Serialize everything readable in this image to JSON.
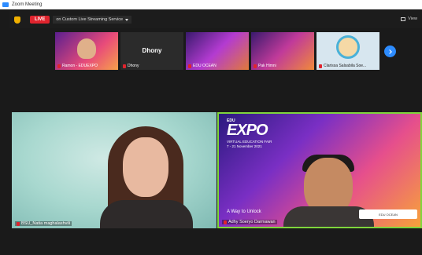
{
  "window": {
    "title": "Zoom Meeting"
  },
  "topbar": {
    "live_label": "LIVE",
    "stream_label": "on Custom Live Streaming Service",
    "view_label": "View"
  },
  "thumbnails": [
    {
      "name": "Ramon - EDUEXPO",
      "muted": true
    },
    {
      "name": "Dhony",
      "muted": true,
      "display_text": "Dhony"
    },
    {
      "name": "EDU OCEAN",
      "muted": true
    },
    {
      "name": "Pak Himni",
      "muted": true
    },
    {
      "name": "Clarissa Salsabila Soe...",
      "muted": true
    }
  ],
  "tiles": {
    "left": {
      "name": "BSU_Natia maghalashvili",
      "muted": true
    },
    "right": {
      "name": "Adhy Soeryo Darmawan",
      "muted": true,
      "slide_small": "EDU",
      "slide_title": "EXPO",
      "slide_subtitle": "VIRTUAL EDUCATION FAIR",
      "slide_date": "7 - 21 November 2021",
      "slide_text": "A Way to Unlock",
      "logos_text": "EDU OCEAN"
    }
  },
  "colors": {
    "live": "#e0242e",
    "accent": "#2d8cff",
    "active_speaker": "#7fd63c"
  }
}
